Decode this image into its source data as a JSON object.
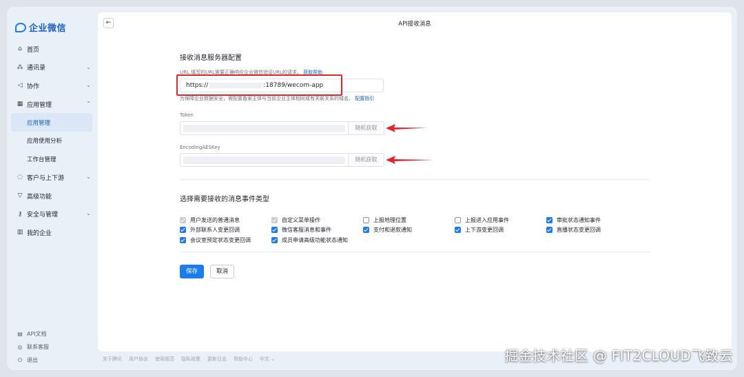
{
  "brand": {
    "logo_icon": "chat-bubble-icon",
    "name": "企业微信"
  },
  "sidebar": {
    "items": [
      {
        "label": "首页",
        "icon": "home-icon"
      },
      {
        "label": "通讯录",
        "icon": "org-chart-icon"
      },
      {
        "label": "协作",
        "icon": "send-icon"
      },
      {
        "label": "应用管理",
        "icon": "grid-icon"
      },
      {
        "label": "客户与上下游",
        "icon": "chat-icon"
      },
      {
        "label": "高级功能",
        "icon": "funnel-icon"
      },
      {
        "label": "安全与管理",
        "icon": "key-icon"
      },
      {
        "label": "我的企业",
        "icon": "building-icon"
      }
    ],
    "sub_items": [
      "应用管理",
      "应用使用分析",
      "工作台管理"
    ],
    "bottom": [
      {
        "label": "API文档",
        "icon": "doc-icon"
      },
      {
        "label": "联系客服",
        "icon": "headset-icon"
      },
      {
        "label": "退出",
        "icon": "power-icon"
      }
    ]
  },
  "header": {
    "title": "API接收消息",
    "back_icon": "arrow-left-icon"
  },
  "server_config": {
    "title": "接收消息服务器配置",
    "url_hint": "URL 填写的URL需要正确响应企业微信验证URL的请求。",
    "url_help_link": "获取帮助",
    "url_prefix": "https://",
    "url_suffix": ":18789/wecom-app",
    "domain_hint": "为保障企业数据安全，需配置备案主体与当前企业主体相同或有关联关系的域名。",
    "domain_link": "配置指引",
    "token_label": "Token",
    "aes_label": "EncodingAESKey",
    "random_button": "随机获取"
  },
  "events": {
    "title": "选择需要接收的消息事件类型",
    "rows": [
      [
        {
          "label": "用户发送的普通消息",
          "state": "dis"
        },
        {
          "label": "自定义菜单操作",
          "state": "dis"
        },
        {
          "label": "上报地理位置",
          "state": "off"
        },
        {
          "label": "上报进入应用事件",
          "state": "off"
        },
        {
          "label": "审批状态通知事件",
          "state": "on"
        }
      ],
      [
        {
          "label": "外部联系人变更回调",
          "state": "on"
        },
        {
          "label": "微信客服消息和事件",
          "state": "on"
        },
        {
          "label": "支付和退款通知",
          "state": "on"
        },
        {
          "label": "上下游变更回调",
          "state": "on"
        },
        {
          "label": "直播状态变更回调",
          "state": "on"
        }
      ],
      [
        {
          "label": "会议室预定状态变更回调",
          "state": "on"
        },
        {
          "label": "成员申请高级功能状态通知",
          "state": "on"
        }
      ]
    ]
  },
  "actions": {
    "save": "保存",
    "cancel": "取消"
  },
  "footer": [
    "关于腾讯",
    "用户协议",
    "使用规范",
    "隐私政策",
    "更新日志",
    "帮助中心",
    "中文 ⌄"
  ],
  "watermark": "掘金技术社区 @ FIT2CLOUD飞致云",
  "colors": {
    "accent": "#1a7cf0",
    "highlight": "#e0262b"
  }
}
